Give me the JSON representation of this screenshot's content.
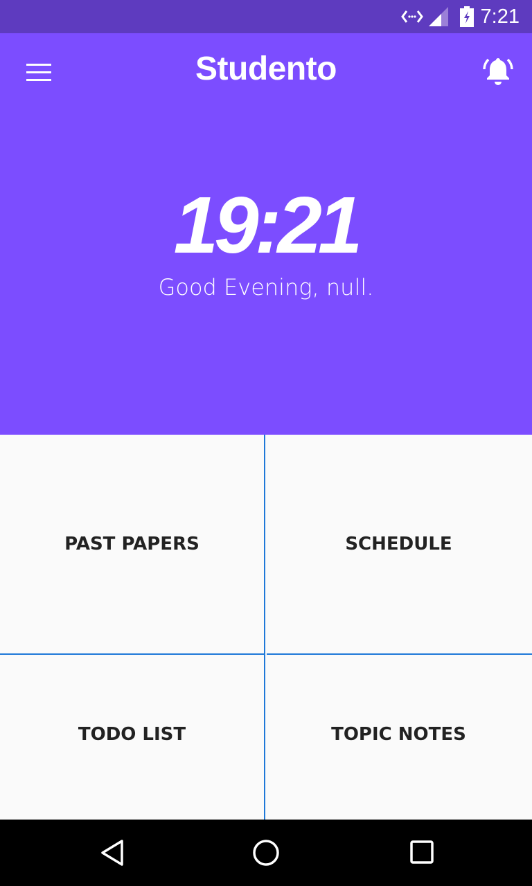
{
  "status_bar": {
    "time": "7:21",
    "icons": [
      "data-arrows-icon",
      "signal-icon",
      "battery-charging-icon"
    ]
  },
  "app_bar": {
    "title": "Studento",
    "menu_icon": "hamburger-menu-icon",
    "bell_icon": "bell-ringing-icon"
  },
  "hero": {
    "clock": "19:21",
    "greeting": "Good Evening, null."
  },
  "tiles": [
    {
      "label": "PAST PAPERS"
    },
    {
      "label": "SCHEDULE"
    },
    {
      "label": "TODO LIST"
    },
    {
      "label": "TOPIC NOTES"
    }
  ],
  "colors": {
    "primary": "#7c4dff",
    "status_bar": "#5e3bbf",
    "divider": "#1e78d8"
  }
}
